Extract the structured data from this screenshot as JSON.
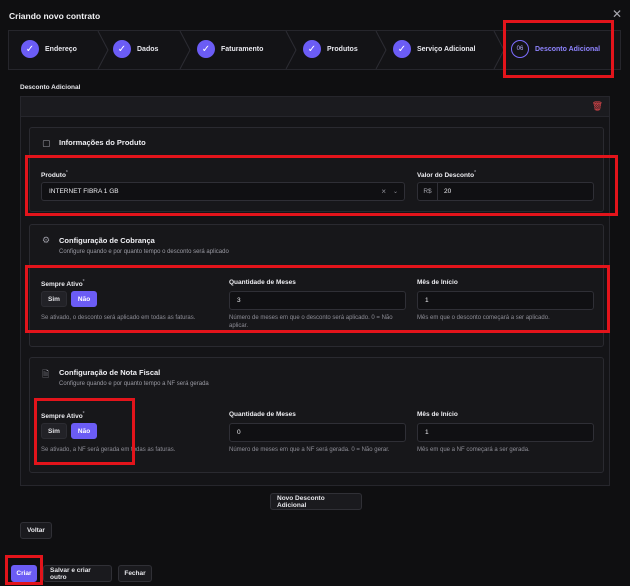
{
  "modal": {
    "title": "Criando novo contrato",
    "close": "✕"
  },
  "steps": [
    {
      "label": "Endereço",
      "mark": "✓"
    },
    {
      "label": "Dados",
      "mark": "✓"
    },
    {
      "label": "Faturamento",
      "mark": "✓"
    },
    {
      "label": "Produtos",
      "mark": "✓"
    },
    {
      "label": "Serviço Adicional",
      "mark": "✓"
    },
    {
      "label": "Desconto Adicional",
      "mark": "06"
    }
  ],
  "section": {
    "title": "Desconto Adicional"
  },
  "produto_card": {
    "title": "Informações do Produto",
    "produto_label": "Produto",
    "produto_value": "INTERNET FIBRA 1 GB",
    "valor_label": "Valor do Desconto",
    "valor_prefix": "R$",
    "valor_value": "20"
  },
  "cobranca_card": {
    "title": "Configuração de Cobrança",
    "desc": "Configure quando e por quanto tempo o desconto será aplicado",
    "sempre_label": "Sempre Ativo",
    "sim": "Sim",
    "nao": "Não",
    "sempre_hint": "Se ativado, o desconto será aplicado em todas as faturas.",
    "qtd_label": "Quantidade de Meses",
    "qtd_value": "3",
    "qtd_hint": "Número de meses em que o desconto será aplicado. 0 = Não aplicar.",
    "mes_label": "Mês de Início",
    "mes_value": "1",
    "mes_hint": "Mês em que o desconto começará a ser aplicado."
  },
  "nf_card": {
    "title": "Configuração de Nota Fiscal",
    "desc": "Configure quando e por quanto tempo a NF será gerada",
    "sempre_label": "Sempre Ativo",
    "sim": "Sim",
    "nao": "Não",
    "sempre_hint": "Se ativado, a NF será gerada em todas as faturas.",
    "qtd_label": "Quantidade de Meses",
    "qtd_value": "0",
    "qtd_hint": "Número de meses em que a NF será gerada. 0 = Não gerar.",
    "mes_label": "Mês de Início",
    "mes_value": "1",
    "mes_hint": "Mês em que a NF começará a ser gerada."
  },
  "actions": {
    "novo": "Novo Desconto Adicional",
    "voltar": "Voltar",
    "criar": "Criar",
    "salvar": "Salvar e criar outro",
    "fechar": "Fechar"
  },
  "colors": {
    "accent": "#6b5cf5",
    "danger": "#e5484d",
    "highlight": "#e3141b"
  }
}
